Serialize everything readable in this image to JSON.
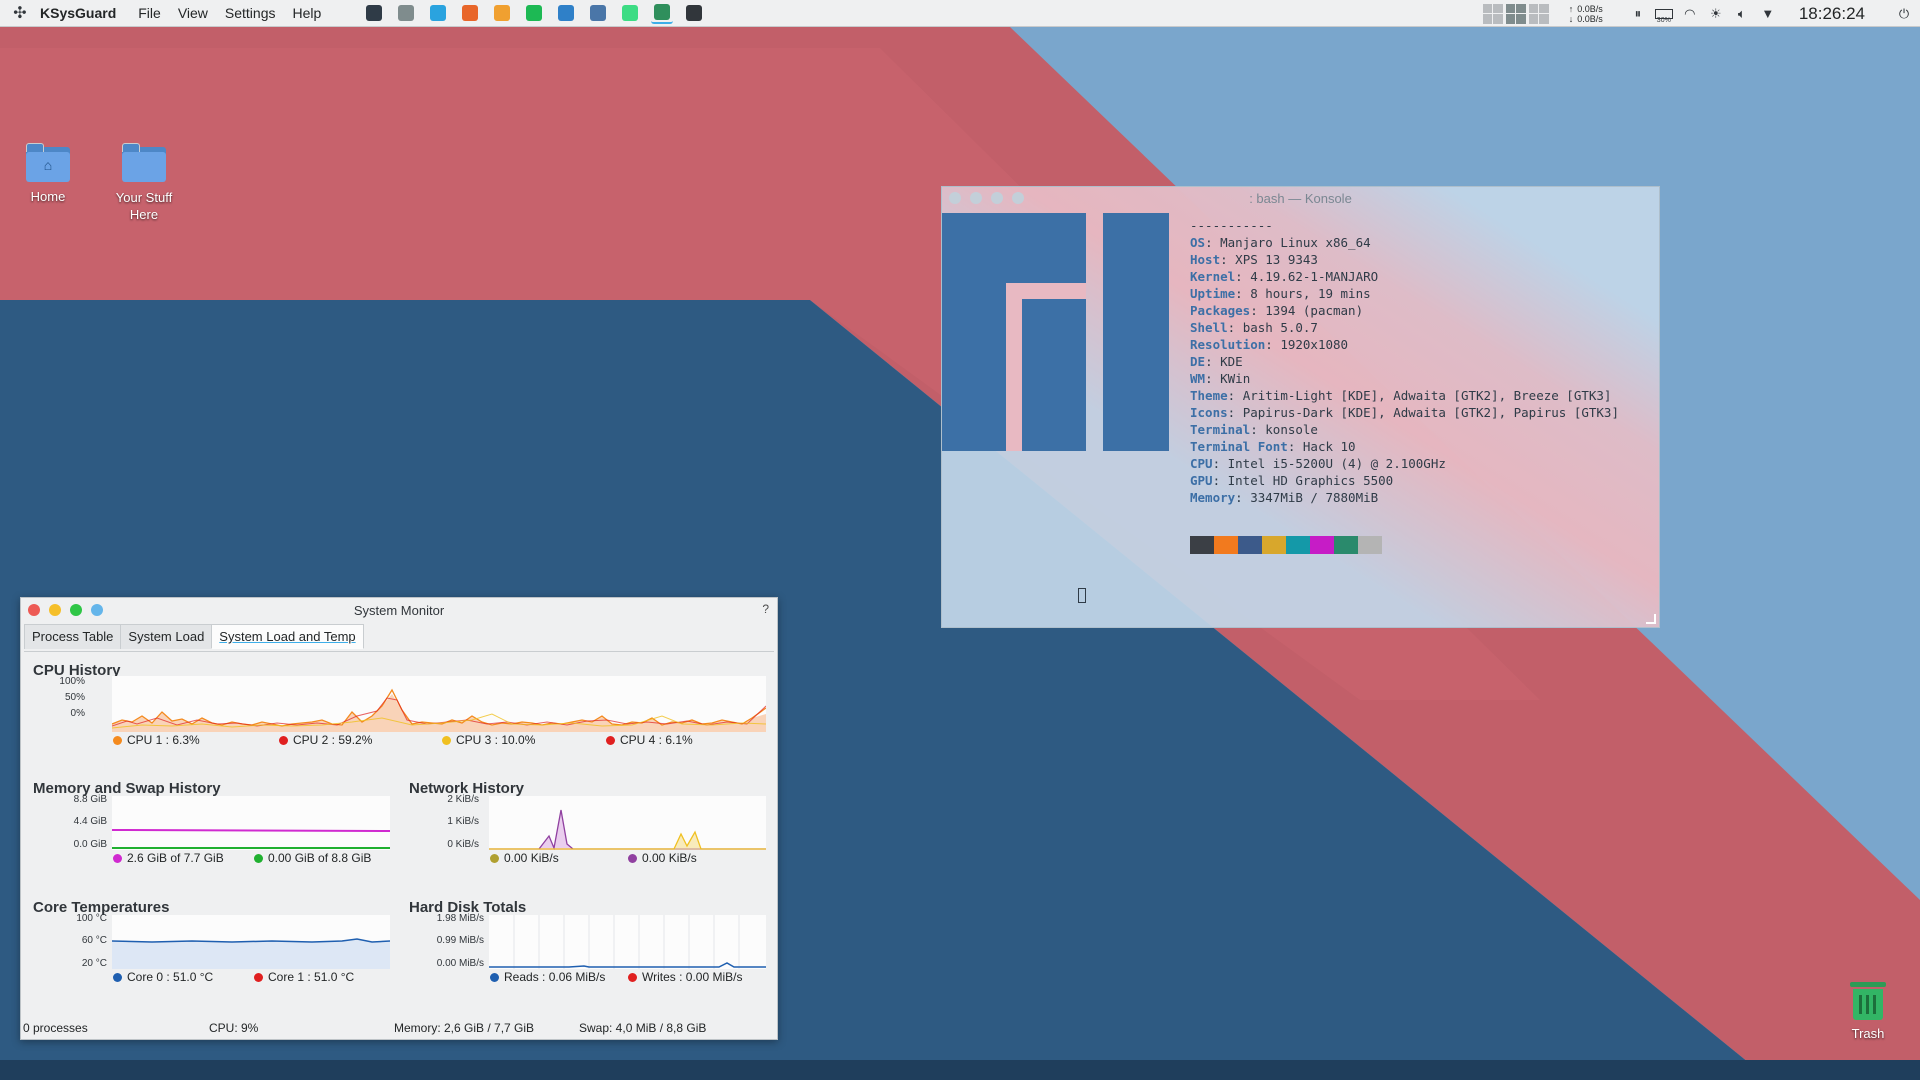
{
  "colors": {
    "panel_bg": "#eff0f1",
    "accent": "#3daee9",
    "manjaro_blue": "#3c70a6"
  },
  "topbar": {
    "app_name": "KSysGuard",
    "menus": [
      "File",
      "View",
      "Settings",
      "Help"
    ],
    "tasks": [
      {
        "icon": "terminal-icon",
        "color": "#2f3b47"
      },
      {
        "icon": "file-manager-icon",
        "color": "#7f8c8d"
      },
      {
        "icon": "telegram-icon",
        "color": "#2aa3df"
      },
      {
        "icon": "firefox-icon",
        "color": "#e8662a"
      },
      {
        "icon": "night-color-icon",
        "color": "#f0a030"
      },
      {
        "icon": "spotify-icon",
        "color": "#1db954"
      },
      {
        "icon": "vscode-icon",
        "color": "#2f80c8"
      },
      {
        "icon": "vk-icon",
        "color": "#4a76a8"
      },
      {
        "icon": "android-icon",
        "color": "#3ddc84"
      },
      {
        "icon": "system-monitor-icon",
        "color": "#2f8f5c"
      },
      {
        "icon": "settings-icon",
        "color": "#31363b"
      }
    ],
    "net_up": "0.0B/s",
    "net_down": "0.0B/s",
    "battery": "30%",
    "clock": "18:26:24"
  },
  "desktop": {
    "icons": [
      {
        "label": "Home"
      },
      {
        "label": "Your Stuff Here"
      }
    ],
    "trash_label": "Trash"
  },
  "konsole": {
    "title": ": bash — Konsole",
    "separator": "-----------",
    "info": [
      {
        "key": "OS",
        "value": " Manjaro Linux x86_64"
      },
      {
        "key": "Host",
        "value": " XPS 13 9343"
      },
      {
        "key": "Kernel",
        "value": " 4.19.62-1-MANJARO"
      },
      {
        "key": "Uptime",
        "value": " 8 hours, 19 mins"
      },
      {
        "key": "Packages",
        "value": " 1394 (pacman)"
      },
      {
        "key": "Shell",
        "value": " bash 5.0.7"
      },
      {
        "key": "Resolution",
        "value": " 1920x1080"
      },
      {
        "key": "DE",
        "value": " KDE"
      },
      {
        "key": "WM",
        "value": " KWin"
      },
      {
        "key": "Theme",
        "value": " Aritim-Light [KDE], Adwaita [GTK2], Breeze [GTK3]"
      },
      {
        "key": "Icons",
        "value": " Papirus-Dark [KDE], Adwaita [GTK2], Papirus [GTK3]"
      },
      {
        "key": "Terminal",
        "value": " konsole"
      },
      {
        "key": "Terminal Font",
        "value": " Hack 10"
      },
      {
        "key": "CPU",
        "value": " Intel i5-5200U (4) @ 2.100GHz"
      },
      {
        "key": "GPU",
        "value": " Intel HD Graphics 5500"
      },
      {
        "key": "Memory",
        "value": " 3347MiB / 7880MiB"
      }
    ],
    "swatches": [
      "#3b3f45",
      "#f27a1e",
      "#3c5a8a",
      "#d8a72c",
      "#1499a8",
      "#c61cc6",
      "#2a8a6c",
      "#b4b4b4"
    ]
  },
  "sysmon": {
    "title": "System Monitor",
    "help": "?",
    "tabs": [
      "Process Table",
      "System Load",
      "System Load and Temp"
    ],
    "cpu": {
      "title": "CPU History",
      "yticks": [
        "100%",
        "50%",
        "0%"
      ],
      "legend": [
        {
          "label": "CPU 1 : 6.3%",
          "color": "#f48a1e"
        },
        {
          "label": "CPU 2 : 59.2%",
          "color": "#e02020"
        },
        {
          "label": "CPU 3 : 10.0%",
          "color": "#f0c020"
        },
        {
          "label": "CPU 4 : 6.1%",
          "color": "#e02020"
        }
      ]
    },
    "memory": {
      "title": "Memory and Swap History",
      "yticks": [
        "8.8 GiB",
        "4.4 GiB",
        "0.0 GiB"
      ],
      "legend": [
        {
          "label": "2.6 GiB of 7.7 GiB",
          "color": "#d02ad0"
        },
        {
          "label": "0.00 GiB of 8.8 GiB",
          "color": "#20b030"
        }
      ]
    },
    "network": {
      "title": "Network History",
      "yticks": [
        "2 KiB/s",
        "1 KiB/s",
        "0 KiB/s"
      ],
      "legend": [
        {
          "label": "0.00 KiB/s",
          "color": "#b0a030"
        },
        {
          "label": "0.00 KiB/s",
          "color": "#9040a0"
        }
      ]
    },
    "temps": {
      "title": "Core Temperatures",
      "yticks": [
        "100 °C",
        "60 °C",
        "20 °C"
      ],
      "legend": [
        {
          "label": "Core 0 : 51.0 °C",
          "color": "#1f5fb0"
        },
        {
          "label": "Core 1 : 51.0 °C",
          "color": "#e02020"
        }
      ]
    },
    "disk": {
      "title": "Hard Disk Totals",
      "yticks": [
        "1.98 MiB/s",
        "0.99 MiB/s",
        "0.00 MiB/s"
      ],
      "legend": [
        {
          "label": "Reads : 0.06 MiB/s",
          "color": "#1f5fb0"
        },
        {
          "label": "Writes : 0.00 MiB/s",
          "color": "#e02020"
        }
      ]
    },
    "status": {
      "processes": "0 processes",
      "cpu": "CPU: 9%",
      "memory": "Memory: 2,6 GiB / 7,7 GiB",
      "swap": "Swap: 4,0 MiB / 8,8 GiB"
    }
  }
}
